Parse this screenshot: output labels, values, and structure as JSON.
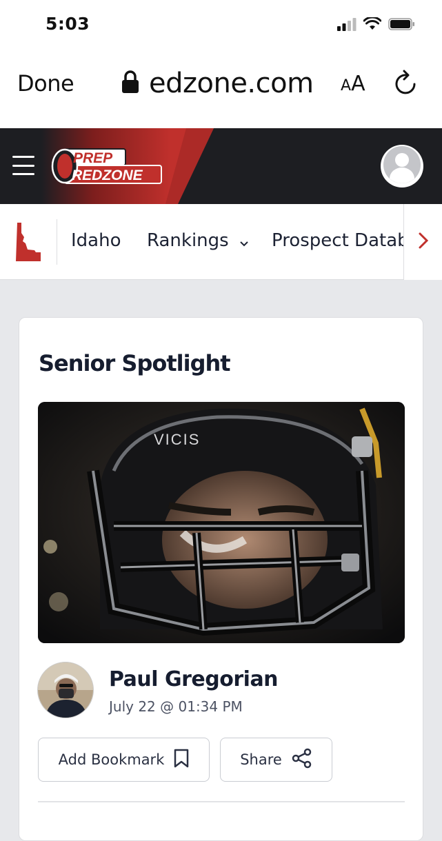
{
  "status_bar": {
    "time": "5:03"
  },
  "browser": {
    "done_label": "Done",
    "url": "edzone.com",
    "aa_label_small": "A",
    "aa_label_large": "A"
  },
  "header": {
    "logo_line1": "PREP",
    "logo_line2": "REDZONE",
    "brand_color": "#c0302c",
    "dark_color": "#1d1e22"
  },
  "subnav": {
    "state": "Idaho",
    "items": [
      "Rankings",
      "Prospect Datab"
    ]
  },
  "article": {
    "title": "Senior Spotlight",
    "author": "Paul Gregorian",
    "date": "July 22 @ 01:34 PM",
    "hero_helmet_text": "VICIS",
    "bookmark_label": "Add Bookmark",
    "share_label": "Share"
  }
}
